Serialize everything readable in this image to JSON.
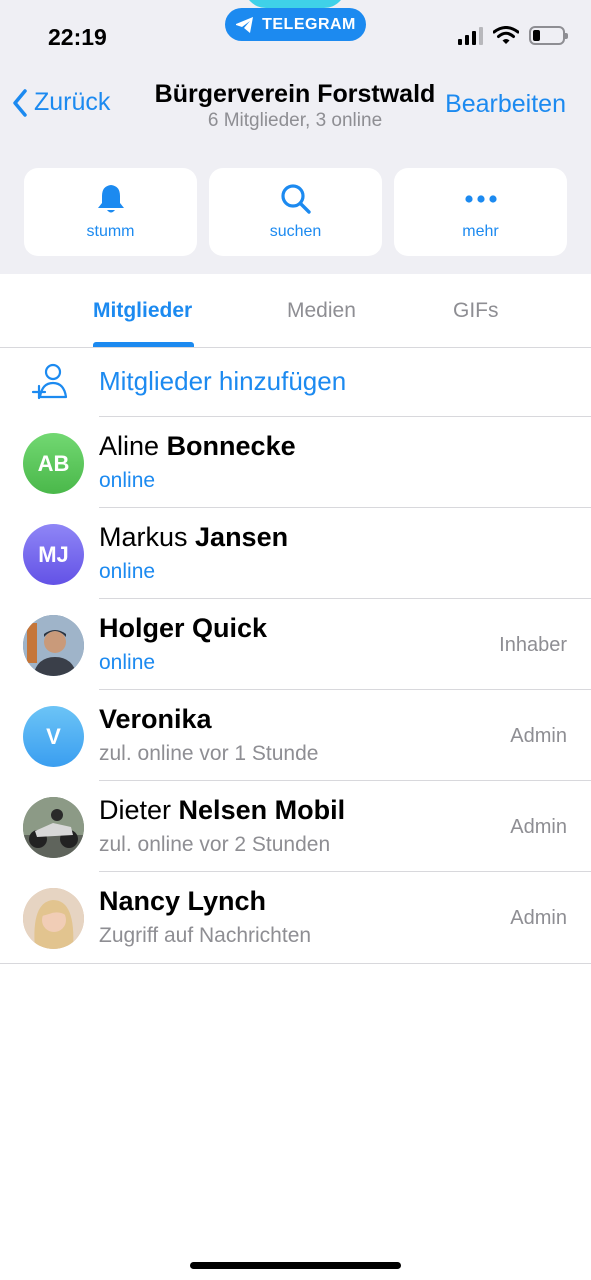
{
  "status_bar": {
    "time": "22:19",
    "pill_label": "TELEGRAM"
  },
  "nav": {
    "back_label": "Zurück",
    "edit_label": "Bearbeiten",
    "title": "Bürgerverein Forstwald",
    "subtitle": "6 Mitglieder, 3 online"
  },
  "actions": [
    {
      "label": "stumm",
      "icon": "bell-icon"
    },
    {
      "label": "suchen",
      "icon": "search-icon"
    },
    {
      "label": "mehr",
      "icon": "more-icon"
    }
  ],
  "tabs": [
    {
      "label": "Mitglieder",
      "active": true
    },
    {
      "label": "Medien",
      "active": false
    },
    {
      "label": "GIFs",
      "active": false
    }
  ],
  "add_member_label": "Mitglieder hinzufügen",
  "members": [
    {
      "first": "Aline",
      "last": "Bonnecke",
      "initials": "AB",
      "status": "online",
      "online": true,
      "role": "",
      "avatar_color": "#5cc95c"
    },
    {
      "first": "Markus",
      "last": "Jansen",
      "initials": "MJ",
      "status": "online",
      "online": true,
      "role": "",
      "avatar_color": "#7b6ef0"
    },
    {
      "first": "",
      "last": "Holger Quick",
      "initials": "",
      "status": "online",
      "online": true,
      "role": "Inhaber",
      "avatar_color": "#8a6a52"
    },
    {
      "first": "",
      "last": "Veronika",
      "initials": "V",
      "status": "zul. online vor 1 Stunde",
      "online": false,
      "role": "Admin",
      "avatar_color": "#4aaef0"
    },
    {
      "first": "Dieter",
      "last": "Nelsen Mobil",
      "initials": "",
      "status": "zul. online vor 2 Stunden",
      "online": false,
      "role": "Admin",
      "avatar_color": "#7d8a7a"
    },
    {
      "first": "",
      "last": "Nancy Lynch",
      "initials": "",
      "status": "Zugriff auf Nachrichten",
      "online": false,
      "role": "Admin",
      "avatar_color": "#d9b89a"
    }
  ]
}
